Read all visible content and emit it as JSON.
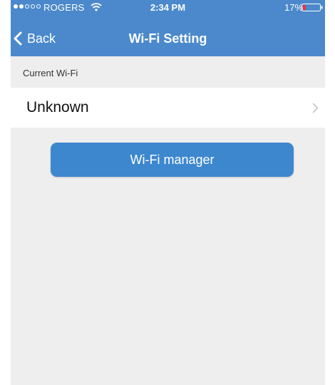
{
  "status_bar": {
    "carrier": "ROGERS",
    "time": "2:34 PM",
    "battery_percent": "17%",
    "signal_bars_filled": 2,
    "signal_bars_total": 5,
    "battery_level": 0.17,
    "battery_color": "#ff2d2d",
    "wifi_icon": "wifi-icon"
  },
  "nav": {
    "back_label": "Back",
    "back_icon": "chevron-left-icon",
    "title": "Wi-Fi Setting"
  },
  "current_wifi": {
    "section_label": "Current Wi-Fi",
    "name": "Unknown",
    "row_icon": "chevron-right-icon"
  },
  "actions": {
    "manager_label": "Wi-Fi manager"
  },
  "colors": {
    "header_bg": "#4b89cc",
    "button_bg": "#3d87cf",
    "page_bg": "#eeeeee"
  }
}
